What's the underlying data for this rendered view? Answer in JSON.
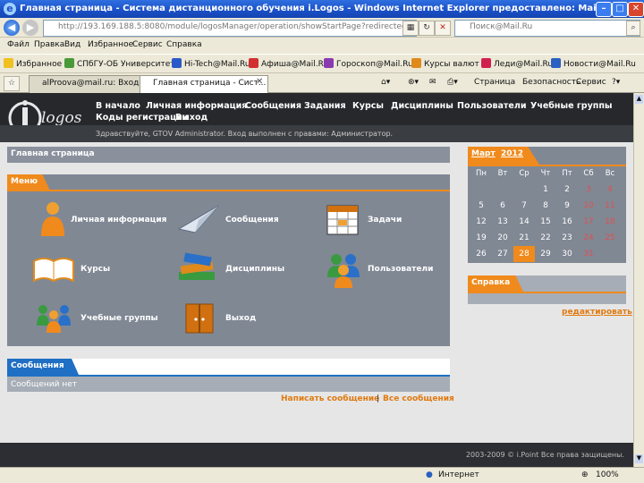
{
  "window": {
    "title": "Главная страница - Система дистанционного обучения i.Logos - Windows Internet Explorer предоставлено: Mail.Ru",
    "url": "http://193.169.188.5:8080/module/logosManager/operation/showStartPage?redirected",
    "search_placeholder": "Поиск@Mail.Ru"
  },
  "menu": [
    "Файл",
    "Правка",
    "Вид",
    "Избранное",
    "Сервис",
    "Справка"
  ],
  "favorites": {
    "label": "Избранное",
    "items": [
      "СПбГУ-ОБ Университете",
      "Hi-Tech@Mail.Ru",
      "Афиша@Mail.Ru",
      "Гороскоп@Mail.Ru",
      "Курсы валют",
      "Леди@Mail.Ru",
      "Новости@Mail.Ru"
    ]
  },
  "tabs": [
    "alProova@mail.ru: Входящие",
    "Главная страница - Сист..."
  ],
  "commands": [
    "Страница",
    "Безопасность",
    "Сервис"
  ],
  "site": {
    "logo_text": "logos",
    "nav": [
      "В начало",
      "Личная информация",
      "Сообщения",
      "Задания",
      "Курсы",
      "Дисциплины",
      "Пользователи",
      "Учебные группы",
      "Коды регистрации",
      "Выход"
    ],
    "greeting": "Здравствуйте, GTOV Administrator. Вход выполнен с правами: Администратор."
  },
  "main": {
    "page_title": "Главная страница",
    "menu_label": "Меню",
    "items": [
      "Личная информация",
      "Сообщения",
      "Задачи",
      "Курсы",
      "Дисциплины",
      "Пользователи",
      "Учебные группы",
      "Выход"
    ],
    "messages_label": "Сообщения",
    "messages_empty": "Сообщений нет",
    "write_link": "Написать сообщение",
    "separator": "|",
    "all_link": "Все сообщения"
  },
  "calendar": {
    "month": "Март",
    "year": "2012",
    "weekdays": [
      "Пн",
      "Вт",
      "Ср",
      "Чт",
      "Пт",
      "Сб",
      "Вс"
    ],
    "weeks": [
      [
        "",
        "",
        "",
        "1",
        "2",
        "3",
        "4"
      ],
      [
        "5",
        "6",
        "7",
        "8",
        "9",
        "10",
        "11"
      ],
      [
        "12",
        "13",
        "14",
        "15",
        "16",
        "17",
        "18"
      ],
      [
        "19",
        "20",
        "21",
        "22",
        "23",
        "24",
        "25"
      ],
      [
        "26",
        "27",
        "28",
        "29",
        "30",
        "31",
        ""
      ]
    ],
    "today": "28"
  },
  "help": {
    "label": "Справка",
    "edit_link": "редактировать"
  },
  "footer": "2003-2009 © i.Point Все права защищены.",
  "status": {
    "zone": "Интернет",
    "zoom": "100%"
  },
  "colors": {
    "accent": "#f08a1c",
    "header": "#26282c",
    "panel": "#808894"
  }
}
